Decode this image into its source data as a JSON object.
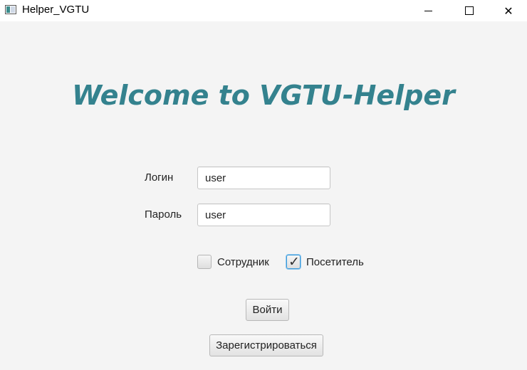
{
  "window": {
    "title": "Helper_VGTU",
    "close_glyph": "✕"
  },
  "main": {
    "welcome_text": "Welcome to VGTU-Helper"
  },
  "form": {
    "login_label": "Логин",
    "login_value": "user",
    "password_label": "Пароль",
    "password_value": "user"
  },
  "roles": {
    "employee": {
      "label": "Сотрудник",
      "checked": false
    },
    "visitor": {
      "label": "Посетитель",
      "checked": true,
      "check_glyph": "✓"
    }
  },
  "buttons": {
    "login_label": "Войти",
    "register_label": "Зарегистрироваться"
  },
  "colors": {
    "welcome": "#34828e",
    "focus_ring": "#3a9ad9"
  }
}
